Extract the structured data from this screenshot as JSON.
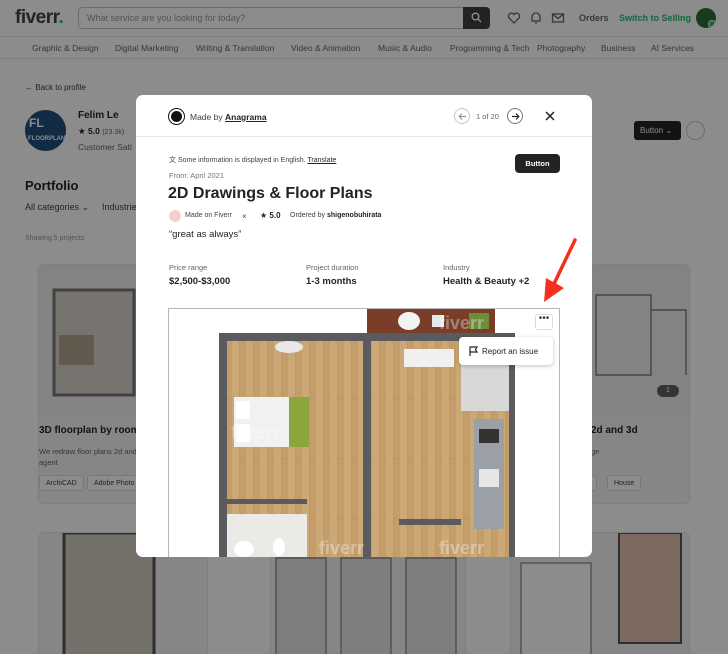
{
  "header": {
    "logo_text": "fiverr",
    "logo_dot": ".",
    "search_placeholder": "What service are you looking for today?",
    "orders": "Orders",
    "switch": "Switch to Selling"
  },
  "categories": [
    "Graphic & Design",
    "Digital Marketing",
    "Writing & Translation",
    "Video & Animation",
    "Music & Audio",
    "Programming & Tech",
    "Photography",
    "Business",
    "AI Services"
  ],
  "profile": {
    "back": "Back to profile",
    "avatar_text": "FL",
    "avatar_sub": "FLOORPLAN",
    "name": "Felim Le",
    "rating": "5.0",
    "reviews": "(23.3k)",
    "subtitle": "Customer Sati",
    "button": "Button"
  },
  "portfolio": {
    "heading": "Portfolio",
    "filter_all": "All categories",
    "filter_ind": "Industries",
    "showing": "Showing 5 projects"
  },
  "cards": {
    "left_title": "3D floorplan by room",
    "left_desc_1": "We redraw floor plans 2d and",
    "left_desc_2": "agent",
    "left_tags": [
      "ArchiCAD",
      "Adobe Photo"
    ],
    "right_title": "2d and 3d",
    "right_desc": "ge",
    "right_tags": [
      "",
      "House"
    ],
    "right_badge": "1"
  },
  "modal": {
    "made_by": "Made by",
    "seller": "Anagrama",
    "counter": "1 of 20",
    "info": "Some information is displayed in English.",
    "translate": "Translate",
    "button": "Button",
    "from": "From: April 2021",
    "title": "2D Drawings & Floor Plans",
    "made_on": "Made on Fiverr",
    "rating": "5.0",
    "ordered_by_label": "Ordered by",
    "ordered_by": "shigenobuhirata",
    "quote": "“great as always”",
    "stats": [
      {
        "label": "Price range",
        "value": "$2,500-$3,000"
      },
      {
        "label": "Project duration",
        "value": "1-3 months"
      },
      {
        "label": "Industry",
        "value": "Health & Beauty +2"
      }
    ],
    "more": "•••",
    "report": "Report an issue",
    "watermark": "fiverr"
  },
  "colors": {
    "brand_green": "#1dbf73",
    "dark": "#222325",
    "arrow": "#f4301f"
  }
}
